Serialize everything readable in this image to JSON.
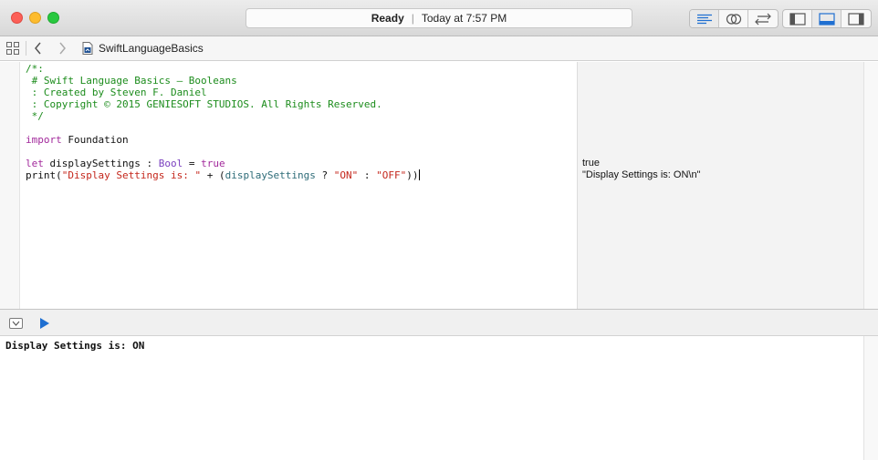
{
  "toolbar": {
    "status": "Ready",
    "time": "Today at 7:57 PM",
    "editor_buttons": [
      {
        "icon": "standard-editor-icon",
        "active": true
      },
      {
        "icon": "assistant-editor-icon",
        "active": false
      },
      {
        "icon": "version-editor-icon",
        "active": false
      }
    ],
    "view_buttons": [
      {
        "icon": "navigator-toggle-icon",
        "active": false
      },
      {
        "icon": "debug-area-toggle-icon",
        "active": true
      },
      {
        "icon": "utilities-toggle-icon",
        "active": false
      }
    ],
    "accent_color": "#1f6fd1"
  },
  "jumpbar": {
    "file_name": "SwiftLanguageBasics"
  },
  "editor": {
    "lines": [
      [
        {
          "t": "/*:",
          "c": "comment"
        }
      ],
      [
        {
          "t": " # Swift Language Basics – Booleans",
          "c": "comment"
        }
      ],
      [
        {
          "t": " : Created by Steven F. Daniel",
          "c": "comment"
        }
      ],
      [
        {
          "t": " : Copyright © 2015 GENIESOFT STUDIOS. All Rights Reserved.",
          "c": "comment"
        }
      ],
      [
        {
          "t": " */",
          "c": "comment"
        }
      ],
      [],
      [
        {
          "t": "import",
          "c": "kw"
        },
        {
          "t": " Foundation",
          "c": "plain"
        }
      ],
      [],
      [
        {
          "t": "let",
          "c": "kw"
        },
        {
          "t": " displaySettings : ",
          "c": "plain"
        },
        {
          "t": "Bool",
          "c": "type"
        },
        {
          "t": " = ",
          "c": "plain"
        },
        {
          "t": "true",
          "c": "kw"
        }
      ],
      [
        {
          "t": "print",
          "c": "plain"
        },
        {
          "t": "(",
          "c": "plain"
        },
        {
          "t": "\"Display Settings is: \"",
          "c": "str"
        },
        {
          "t": " + (",
          "c": "plain"
        },
        {
          "t": "displaySettings",
          "c": "var"
        },
        {
          "t": " ? ",
          "c": "plain"
        },
        {
          "t": "\"ON\"",
          "c": "str"
        },
        {
          "t": " : ",
          "c": "plain"
        },
        {
          "t": "\"OFF\"",
          "c": "str"
        },
        {
          "t": "))",
          "c": "plain"
        }
      ]
    ],
    "caret_line": 9
  },
  "results": [
    {
      "line": 8,
      "text": "true"
    },
    {
      "line": 9,
      "text": "\"Display Settings is: ON\\n\""
    }
  ],
  "console": {
    "output": "Display Settings is: ON"
  }
}
